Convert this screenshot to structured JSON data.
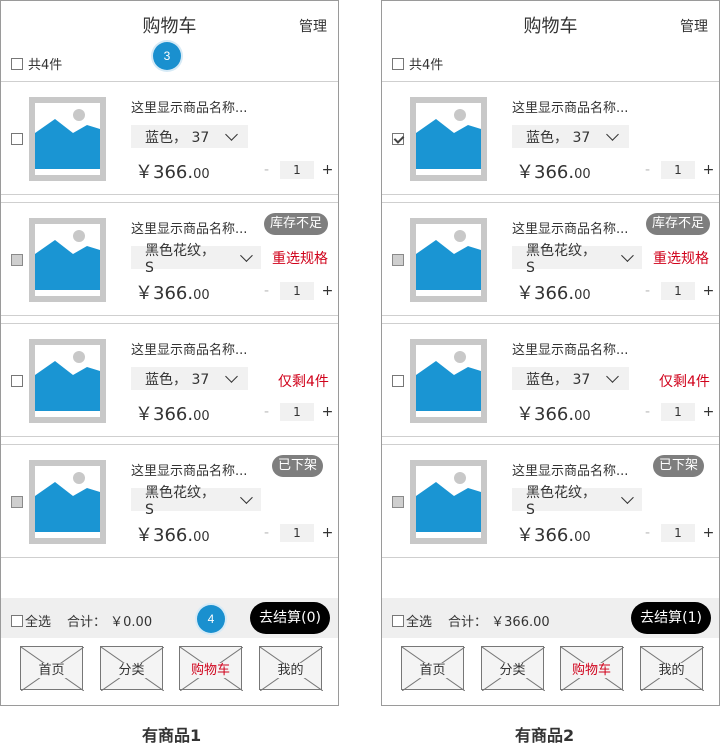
{
  "screens": [
    {
      "title": "购物车",
      "manage": "管理",
      "count_label": "共4件",
      "marker_top": "3",
      "marker_bottom": "4",
      "items": [
        {
          "name": "这里显示商品名称...",
          "spec": "蓝色， 37",
          "price_int": "￥366.",
          "price_dec": "00",
          "qty": "1",
          "checked": false,
          "disabled": false,
          "badge": "",
          "warn": ""
        },
        {
          "name": "这里显示商品名称...",
          "spec": "黑色花纹， S",
          "price_int": "￥366.",
          "price_dec": "00",
          "qty": "1",
          "checked": false,
          "disabled": true,
          "badge": "库存不足",
          "warn": "重选规格"
        },
        {
          "name": "这里显示商品名称...",
          "spec": "蓝色， 37",
          "price_int": "￥366.",
          "price_dec": "00",
          "qty": "1",
          "checked": false,
          "disabled": false,
          "badge": "",
          "warn": "仅剩4件"
        },
        {
          "name": "这里显示商品名称...",
          "spec": "黑色花纹， S",
          "price_int": "￥366.",
          "price_dec": "00",
          "qty": "1",
          "checked": false,
          "disabled": true,
          "badge": "已下架",
          "warn": ""
        }
      ],
      "select_all": "全选",
      "total_label": "合计：",
      "total_value": "￥0.00",
      "checkout": "去结算(0)",
      "tabs": [
        "首页",
        "分类",
        "购物车",
        "我的"
      ],
      "active_tab": 2,
      "caption": "有商品1"
    },
    {
      "title": "购物车",
      "manage": "管理",
      "count_label": "共4件",
      "items": [
        {
          "name": "这里显示商品名称...",
          "spec": "蓝色， 37",
          "price_int": "￥366.",
          "price_dec": "00",
          "qty": "1",
          "checked": true,
          "disabled": false,
          "badge": "",
          "warn": ""
        },
        {
          "name": "这里显示商品名称...",
          "spec": "黑色花纹， S",
          "price_int": "￥366.",
          "price_dec": "00",
          "qty": "1",
          "checked": false,
          "disabled": true,
          "badge": "库存不足",
          "warn": "重选规格"
        },
        {
          "name": "这里显示商品名称...",
          "spec": "蓝色， 37",
          "price_int": "￥366.",
          "price_dec": "00",
          "qty": "1",
          "checked": false,
          "disabled": false,
          "badge": "",
          "warn": "仅剩4件"
        },
        {
          "name": "这里显示商品名称...",
          "spec": "黑色花纹， S",
          "price_int": "￥366.",
          "price_dec": "00",
          "qty": "1",
          "checked": false,
          "disabled": true,
          "badge": "已下架",
          "warn": ""
        }
      ],
      "select_all": "全选",
      "total_label": "合计：",
      "total_value": "￥366.00",
      "checkout": "去结算(1)",
      "tabs": [
        "首页",
        "分类",
        "购物车",
        "我的"
      ],
      "active_tab": 2,
      "caption": "有商品2"
    }
  ],
  "icons": {
    "product_image": "image-placeholder-icon",
    "spec_dropdown": "chevron-down-icon",
    "checkbox": "checkbox-icon"
  },
  "colors": {
    "accent": "#d0021b",
    "marker": "#1a90cf",
    "image_fill": "#1a95d3",
    "badge_bg": "#7e7e7e",
    "checkout_bg": "#000000"
  }
}
